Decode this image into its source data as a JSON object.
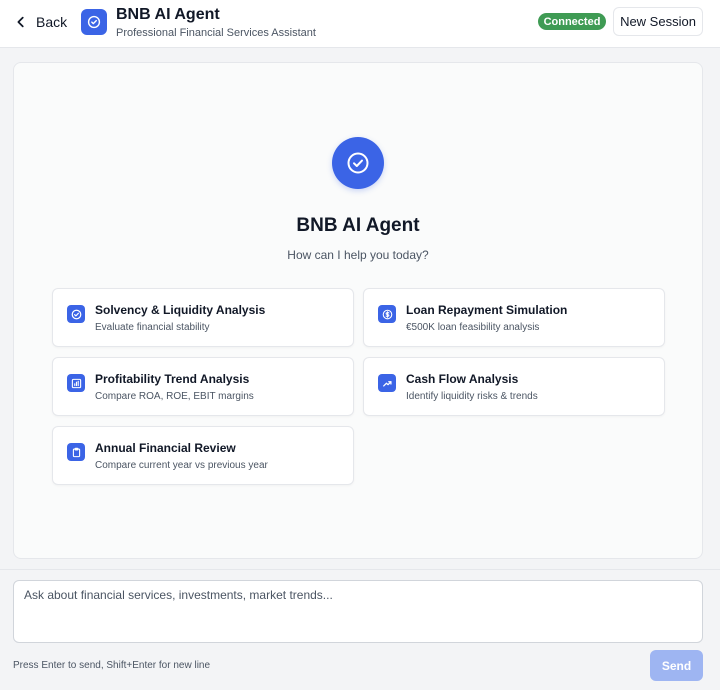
{
  "header": {
    "back_label": "Back",
    "title": "BNB AI Agent",
    "subtitle": "Professional Financial Services Assistant",
    "status": "Connected",
    "new_session_label": "New Session"
  },
  "welcome": {
    "title": "BNB AI Agent",
    "subtitle": "How can I help you today?"
  },
  "suggestions": [
    {
      "icon": "check-circle-icon",
      "title": "Solvency & Liquidity Analysis",
      "description": "Evaluate financial stability"
    },
    {
      "icon": "dollar-circle-icon",
      "title": "Loan Repayment Simulation",
      "description": "€500K loan feasibility analysis"
    },
    {
      "icon": "bar-chart-icon",
      "title": "Profitability Trend Analysis",
      "description": "Compare ROA, ROE, EBIT margins"
    },
    {
      "icon": "trending-up-icon",
      "title": "Cash Flow Analysis",
      "description": "Identify liquidity risks & trends"
    },
    {
      "icon": "clipboard-icon",
      "title": "Annual Financial Review",
      "description": "Compare current year vs previous year"
    }
  ],
  "composer": {
    "placeholder": "Ask about financial services, investments, market trends...",
    "value": "",
    "hint": "Press Enter to send, Shift+Enter for new line",
    "send_label": "Send"
  },
  "colors": {
    "accent": "#3b64e6",
    "status_green": "#3f9b54",
    "send_disabled": "#9eb5f2"
  }
}
